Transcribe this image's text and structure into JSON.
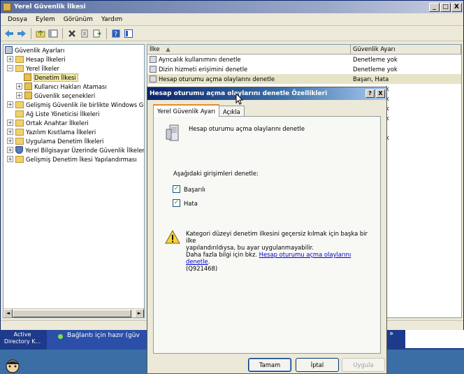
{
  "window": {
    "title": "Yerel Güvenlik İlkesi",
    "btn_min": "_",
    "btn_max": "□",
    "btn_close": "X"
  },
  "menu": [
    "Dosya",
    "Eylem",
    "Görünüm",
    "Yardım"
  ],
  "tree": {
    "items": [
      {
        "label": "Güvenlik Ayarları"
      },
      {
        "label": "Hesap İlkeleri"
      },
      {
        "label": "Yerel İlkeler"
      },
      {
        "label": "Denetim İlkesi"
      },
      {
        "label": "Kullanıcı Hakları Ataması"
      },
      {
        "label": "Güvenlik seçenekleri"
      },
      {
        "label": "Gelişmiş Güvenlik ile birlikte Windows Güve"
      },
      {
        "label": "Ağ Liste Yöneticisi İlkeleri"
      },
      {
        "label": "Ortak Anahtar İlkeleri"
      },
      {
        "label": "Yazılım Kısıtlama İlkeleri"
      },
      {
        "label": "Uygulama Denetim İlkeleri"
      },
      {
        "label": "Yerel Bilgisayar Üzerinde Güvenlik İlkeleri"
      },
      {
        "label": "Gelişmiş Denetim İkesi Yapılandırması"
      }
    ],
    "expanders": {
      "plus": "+",
      "minus": "−"
    }
  },
  "list": {
    "col_policy": "İlke",
    "col_setting": "Güvenlik Ayarı",
    "rows": [
      {
        "policy": "Ayrıcalık kullanımını denetle",
        "setting": "Denetleme yok"
      },
      {
        "policy": "Dizin hizmeti erişimini denetle",
        "setting": "Denetleme yok"
      },
      {
        "policy": "Hesap oturumu açma olaylarını denetle",
        "setting": "Başarı, Hata"
      },
      {
        "policy": "",
        "setting": "k"
      },
      {
        "policy": "",
        "setting": "k"
      },
      {
        "policy": "",
        "setting": "k"
      },
      {
        "policy": "",
        "setting": "k"
      },
      {
        "policy": "",
        "setting": "k"
      }
    ]
  },
  "scroll": {
    "left": "◄",
    "right": "►"
  },
  "taskbar": {
    "ad_label": "Active Directory K...",
    "conn_label": "Bağlantı için hazır (güv",
    "overflow": "»"
  },
  "dialog": {
    "title": "Hesap oturumu açma olaylarını denetle Özellikleri",
    "help_btn": "?",
    "close_btn": "X",
    "tab_local": "Yerel Güvenlik Ayarı",
    "tab_explain": "Açıkla",
    "policy_name": "Hesap oturumu açma olaylarını denetle",
    "audit_label": "Aşağıdaki girişimleri denetle:",
    "success_label": "Başarılı",
    "failure_label": "Hata",
    "success_checked": true,
    "failure_checked": true,
    "check_mark": "✓",
    "warning_line1": "Kategori düzeyi denetim ilkesini geçersiz kılmak için başka bir ilke",
    "warning_line2": "yapılandırıldıysa, bu ayar uygulanmayabilir.",
    "warning_line3_prefix": "Daha fazla bilgi için bkz. ",
    "warning_link": "Hesap oturumu açma olaylarını denetle",
    "warning_line3_suffix": ".",
    "warning_line4": "(Q921468)",
    "ok_button": "Tamam",
    "cancel_button": "İptal",
    "apply_button": "Uygula"
  }
}
